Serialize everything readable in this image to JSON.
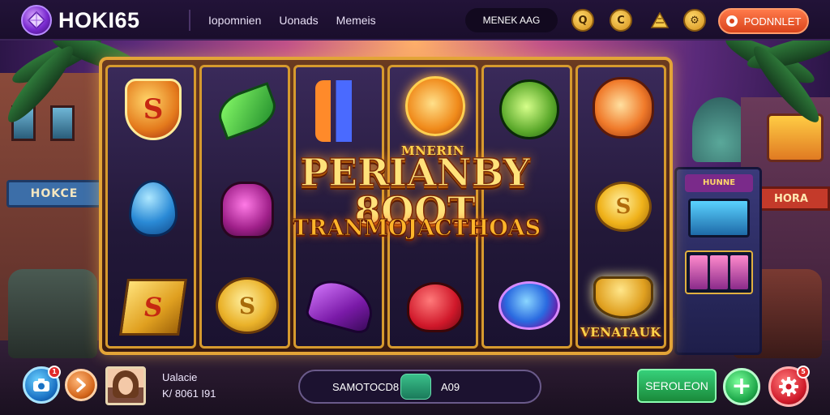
{
  "header": {
    "logo_text": "HOKI65",
    "nav": [
      "Iopomnien",
      "Uonads",
      "Memeis"
    ],
    "search_text": "MENEK AAG",
    "icons": [
      "coin-q-icon",
      "coin-c-icon",
      "pyramid-icon",
      "coin-settings-icon"
    ],
    "cta_label": "PODNNLET"
  },
  "scene": {
    "left_sign": "HOKCE",
    "right_sign": "HORA",
    "arcade_sign": "HUNNE"
  },
  "reels": [
    {
      "symbols": [
        "shield-s-icon",
        "blue-drop-icon",
        "gold-block-s-icon"
      ],
      "shield_letter": "S",
      "block_letter": "S"
    },
    {
      "symbols": [
        "green-leaf-arrow-icon",
        "magenta-vase-icon",
        "gold-coins-icon"
      ],
      "coins_letter": "S"
    },
    {
      "symbols": [
        "potion-tubes-icon",
        "purple-boot-icon"
      ]
    },
    {
      "symbols": [
        "sun-mask-icon",
        "red-heart-arrow-icon"
      ],
      "sun_label": "MNERIN"
    },
    {
      "symbols": [
        "owl-mask-icon",
        "blue-gem-icon"
      ]
    },
    {
      "symbols": [
        "tiger-mask-icon",
        "gold-coin-s-icon",
        "glowing-bowl-icon"
      ],
      "coin_letter": "S",
      "bowl_label": "VENATAUK"
    }
  ],
  "title": {
    "main": "PERIANBY 8OOT",
    "sub": "TRANMOJACTHOAS"
  },
  "bottom": {
    "camera_badge": "1",
    "player_name": "Ualacie",
    "player_balance": "K/ 8061 I91",
    "bet_label": "SAMOTOCD8",
    "bet_value": "A09",
    "spin_label": "SEROLEON",
    "plus_symbol": "+",
    "gear_badge": "5"
  },
  "colors": {
    "frame_gold": "#e3a437",
    "cta": "#d9431c",
    "spin": "#1a8a3a",
    "header_bg": "#1a0e2c"
  }
}
